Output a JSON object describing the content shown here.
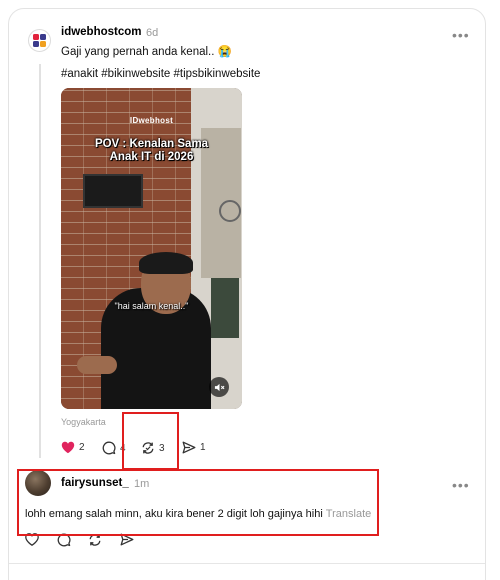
{
  "post": {
    "username": "idwebhostcom",
    "timestamp": "6d",
    "text": "Gaji yang pernah anda kenal.. 😭",
    "hashtags": "#anakit #bikinwebsite #tipsbikinwebsite",
    "video": {
      "logo": "IDwebhost",
      "title_line1": "POV : Kenalan Sama",
      "title_line2": "Anak IT di 2026",
      "subtitle": "\"hai salam kenal..\""
    },
    "location": "Yogyakarta",
    "actions": {
      "likes": "2",
      "comments": "4",
      "reposts": "3",
      "shares": "1"
    },
    "colors": {
      "like": "#e0245e",
      "highlight": "#e01e1e"
    }
  },
  "reply": {
    "username": "fairysunset_",
    "timestamp": "1m",
    "text": "lohh emang salah minn, aku kira bener 2 digit loh gajinya hihi",
    "translate_label": "Translate"
  }
}
